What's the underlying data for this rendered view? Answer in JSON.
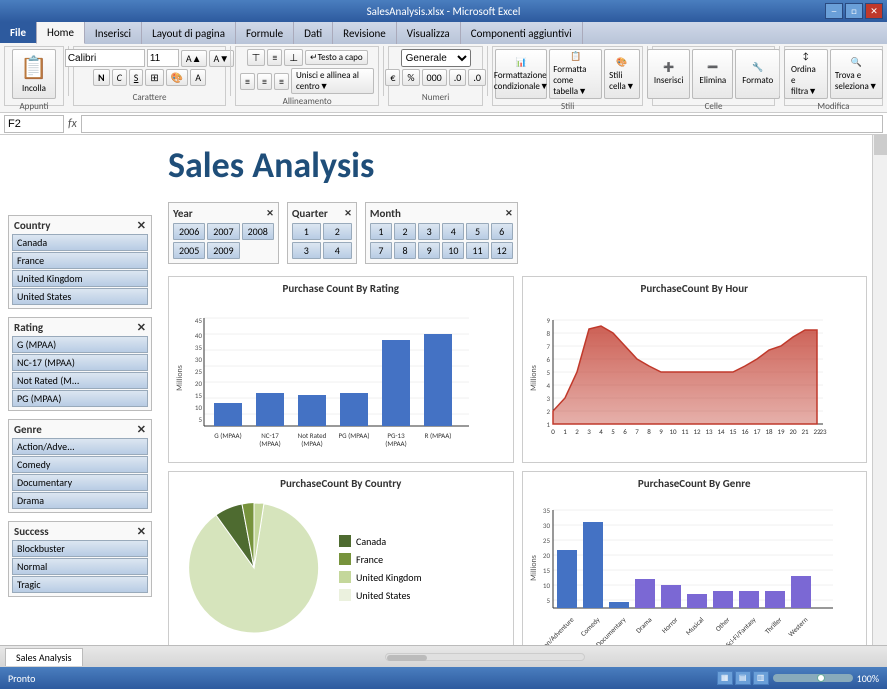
{
  "window": {
    "title": "SalesAnalysis.xlsx - Microsoft Excel",
    "min_btn": "─",
    "max_btn": "□",
    "close_btn": "✕"
  },
  "ribbon": {
    "tabs": [
      "File",
      "Home",
      "Inserisci",
      "Layout di pagina",
      "Formule",
      "Dati",
      "Revisione",
      "Visualizza",
      "Componenti aggiuntivi"
    ],
    "active_tab": "Home",
    "font_name": "Calibri",
    "font_size": "11",
    "cell_ref": "F2",
    "fx": "fx"
  },
  "page": {
    "title": "Sales Analysis"
  },
  "filters": {
    "year": {
      "label": "Year",
      "values": [
        "2006",
        "2007",
        "2008",
        "2005",
        "2009"
      ]
    },
    "quarter": {
      "label": "Quarter",
      "values": [
        "1",
        "2",
        "3",
        "4"
      ]
    },
    "month": {
      "label": "Month",
      "values": [
        "1",
        "2",
        "3",
        "4",
        "5",
        "6",
        "7",
        "8",
        "9",
        "10",
        "11",
        "12"
      ]
    }
  },
  "sidebar": {
    "country": {
      "label": "Country",
      "items": [
        "Canada",
        "France",
        "United Kingdom",
        "United States"
      ]
    },
    "rating": {
      "label": "Rating",
      "items": [
        "G (MPAA)",
        "NC-17 (MPAA)",
        "Not Rated (M...",
        "PG (MPAA)"
      ]
    },
    "genre": {
      "label": "Genre",
      "items": [
        "Action/Adve...",
        "Comedy",
        "Documentary",
        "Drama"
      ]
    },
    "success": {
      "label": "Success",
      "items": [
        "Blockbuster",
        "Normal",
        "Tragic"
      ]
    }
  },
  "chart1": {
    "title": "Purchase Count By Rating",
    "y_label": "Millions",
    "y_ticks": [
      "45",
      "40",
      "35",
      "30",
      "25",
      "20",
      "15",
      "10",
      "5"
    ],
    "bars": [
      {
        "label": "G (MPAA)",
        "value": 8,
        "height_pct": 17
      },
      {
        "label": "NC-17\n(MPAA)",
        "value": 14,
        "height_pct": 30
      },
      {
        "label": "Not Rated\n(MPAA)",
        "value": 13,
        "height_pct": 28
      },
      {
        "label": "PG (MPAA)",
        "value": 14,
        "height_pct": 30
      },
      {
        "label": "PG-13\n(MPAA)",
        "value": 38,
        "height_pct": 82
      },
      {
        "label": "R (MPAA)",
        "value": 41,
        "height_pct": 88
      }
    ]
  },
  "chart2": {
    "title": "PurchaseCount By Hour",
    "y_label": "Millions",
    "y_ticks": [
      "9",
      "8",
      "7",
      "6",
      "5",
      "4",
      "3",
      "2",
      "1"
    ]
  },
  "chart3": {
    "title": "PurchaseCount By Country",
    "legend": [
      {
        "label": "Canada",
        "color": "#4e6b30"
      },
      {
        "label": "France",
        "color": "#77933c"
      },
      {
        "label": "United Kingdom",
        "color": "#c4d79b"
      },
      {
        "label": "United States",
        "color": "#ebf1de"
      }
    ]
  },
  "chart4": {
    "title": "PurchaseCount By Genre",
    "y_label": "Millions",
    "y_ticks": [
      "35",
      "30",
      "25",
      "20",
      "15",
      "10",
      "5"
    ],
    "bars": [
      {
        "label": "Action/Adventure",
        "value": 20,
        "height_pct": 57
      },
      {
        "label": "Comedy",
        "value": 30,
        "height_pct": 86
      },
      {
        "label": "Documentary",
        "value": 2,
        "height_pct": 6
      },
      {
        "label": "Drama",
        "value": 10,
        "height_pct": 29
      },
      {
        "label": "Horror",
        "value": 8,
        "height_pct": 23
      },
      {
        "label": "Musical",
        "value": 5,
        "height_pct": 14
      },
      {
        "label": "Other",
        "value": 6,
        "height_pct": 17
      },
      {
        "label": "Sci-Fi/Fantasy",
        "value": 6,
        "height_pct": 17
      },
      {
        "label": "Thriller",
        "value": 6,
        "height_pct": 17
      },
      {
        "label": "Western",
        "value": 11,
        "height_pct": 31
      }
    ]
  },
  "bottom": {
    "sheet_tab": "Sales Analysis",
    "status": "Pronto",
    "zoom": "100%"
  }
}
